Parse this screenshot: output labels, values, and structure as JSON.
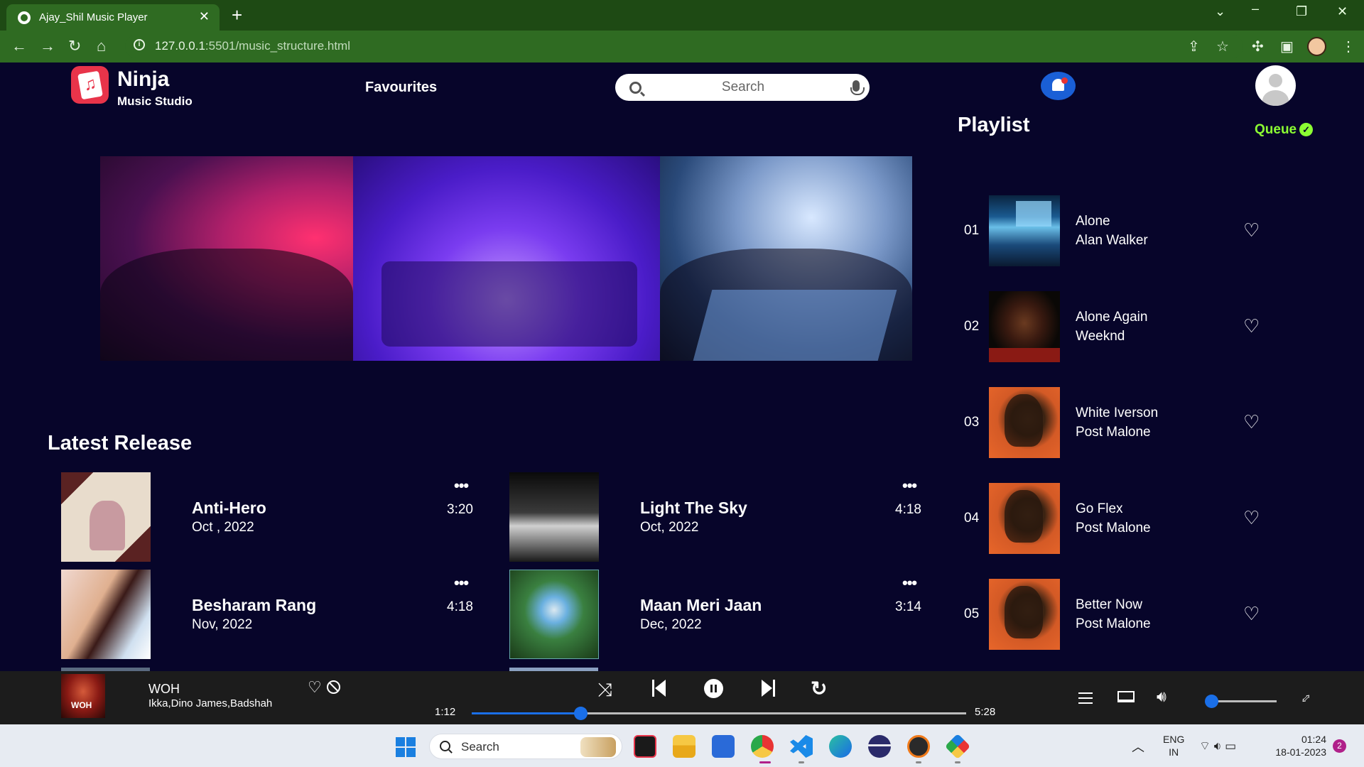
{
  "browser": {
    "tab_title": "Ajay_Shil Music Player",
    "tab_close": "✕",
    "new_tab": "+",
    "url_host": "127.0.0.1",
    "url_path": ":5501/music_structure.html"
  },
  "header": {
    "brand_name": "Ninja",
    "brand_sub": "Music Studio",
    "nav_favourites": "Favourites",
    "search_placeholder": "Search"
  },
  "playlist": {
    "title": "Playlist",
    "queue_label": "Queue",
    "items": [
      {
        "num": "01",
        "name": "Alone",
        "artist": "Alan Walker"
      },
      {
        "num": "02",
        "name": "Alone Again",
        "artist": "Weeknd"
      },
      {
        "num": "03",
        "name": "White Iverson",
        "artist": "Post Malone"
      },
      {
        "num": "04",
        "name": "Go Flex",
        "artist": "Post Malone"
      },
      {
        "num": "05",
        "name": "Better Now",
        "artist": "Post Malone"
      }
    ]
  },
  "latest": {
    "title": "Latest Release",
    "songs": [
      {
        "title": "Anti-Hero",
        "date": "Oct , 2022",
        "duration": "3:20"
      },
      {
        "title": "Light The Sky",
        "date": "Oct, 2022",
        "duration": "4:18"
      },
      {
        "title": "Besharam Rang",
        "date": "Nov, 2022",
        "duration": "4:18"
      },
      {
        "title": "Maan Meri Jaan",
        "date": "Dec, 2022",
        "duration": "3:14"
      }
    ],
    "more_icon": "•••"
  },
  "player": {
    "title": "WOH",
    "artist": "Ikka,Dino James,Badshah",
    "current_time": "1:12",
    "total_time": "5:28",
    "progress": 0.2195,
    "volume": 0.08
  },
  "taskbar": {
    "search_label": "Search",
    "lang_1": "ENG",
    "lang_2": "IN",
    "time": "01:24",
    "date": "18-01-2023",
    "notifications": "2"
  },
  "colors": {
    "page_bg": "#07052a",
    "accent_blue": "#1a6fe8",
    "queue_green": "#8cff33",
    "logo_red": "#e8344a",
    "chrome_green": "#2f6b22"
  }
}
